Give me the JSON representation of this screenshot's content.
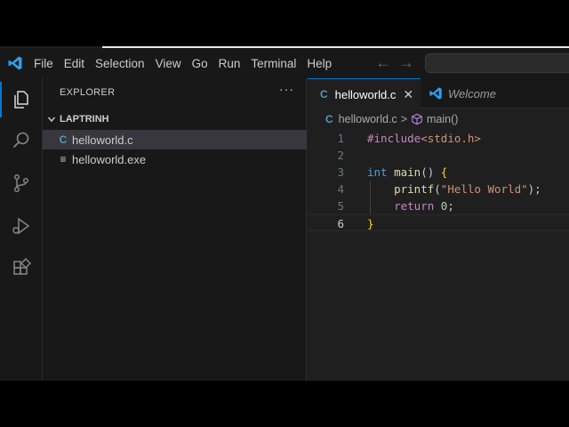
{
  "menu": {
    "items": [
      "File",
      "Edit",
      "Selection",
      "View",
      "Go",
      "Run",
      "Terminal",
      "Help"
    ]
  },
  "nav": {
    "back_icon": "arrow-left-icon",
    "forward_icon": "arrow-right-icon"
  },
  "activity_bar": {
    "items": [
      "explorer-icon",
      "search-icon",
      "source-control-icon",
      "run-debug-icon",
      "extensions-icon"
    ],
    "active": "explorer-icon"
  },
  "sidebar": {
    "title": "EXPLORER",
    "more": "···",
    "folder": "LAPTRINH",
    "files": [
      {
        "icon": "C",
        "name": "helloworld.c",
        "selected": true
      },
      {
        "icon": "≡",
        "name": "helloworld.exe",
        "selected": false
      }
    ]
  },
  "tabs": [
    {
      "icon": "C",
      "label": "helloworld.c",
      "active": true,
      "close": "✕"
    },
    {
      "icon": "vscode-logo-icon",
      "label": "Welcome",
      "active": false
    }
  ],
  "breadcrumb": {
    "file_icon": "C",
    "file": "helloworld.c",
    "separator": ">",
    "symbol": "main()"
  },
  "code": {
    "current_line": 6,
    "lines": [
      {
        "n": "1",
        "parts": [
          [
            "kw-pre",
            "#include"
          ],
          [
            "str",
            "<stdio.h>"
          ]
        ]
      },
      {
        "n": "2",
        "parts": []
      },
      {
        "n": "3",
        "parts": [
          [
            "kw-type",
            "int"
          ],
          [
            "punc",
            " "
          ],
          [
            "fn",
            "main"
          ],
          [
            "punc",
            "() "
          ],
          [
            "brace",
            "{"
          ]
        ]
      },
      {
        "n": "4",
        "parts": [
          [
            "punc",
            "    "
          ],
          [
            "fn",
            "printf"
          ],
          [
            "punc",
            "("
          ],
          [
            "str",
            "\"Hello World\""
          ],
          [
            "punc",
            ");"
          ]
        ]
      },
      {
        "n": "5",
        "parts": [
          [
            "punc",
            "    "
          ],
          [
            "kw-ctl",
            "return"
          ],
          [
            "punc",
            " "
          ],
          [
            "num",
            "0"
          ],
          [
            "punc",
            ";"
          ]
        ]
      },
      {
        "n": "6",
        "parts": [
          [
            "brace",
            "}"
          ]
        ]
      }
    ]
  },
  "colors": {
    "accent": "#0078d4",
    "c_icon": "#519aba",
    "background": "#1f1f1f",
    "sidebar": "#181818"
  }
}
